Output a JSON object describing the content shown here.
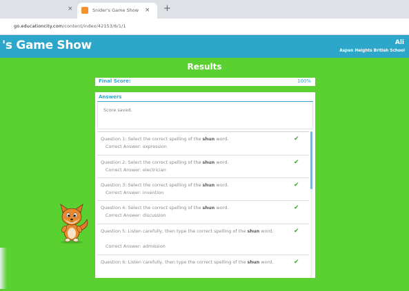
{
  "browser": {
    "prev_tab_close": "×",
    "tab_title": "Snider's Game Show",
    "tab_close": "×",
    "new_tab": "+",
    "url_domain": "go.educationcity.com",
    "url_path": "/content/index/42153/6/1/1"
  },
  "header": {
    "title": "'s Game Show",
    "user": "Ali",
    "school": "Aspen Heights British School"
  },
  "results": {
    "title": "Results",
    "score_label": "Final Score:",
    "score_value": "100%"
  },
  "answers": {
    "header": "Answers",
    "saved": "Score saved."
  },
  "questions": [
    {
      "pre": "Question 1: Select the correct spelling of the ",
      "bold": "shun",
      "post": " word.",
      "answer": "Correct Answer:  expression"
    },
    {
      "pre": "Question 2: Select the correct spelling of the ",
      "bold": "shun",
      "post": " word.",
      "answer": "Correct Answer:  electrician"
    },
    {
      "pre": "Question 3: Select the correct spelling of the ",
      "bold": "shun",
      "post": " word.",
      "answer": "Correct Answer:  invention"
    },
    {
      "pre": "Question 4: Select the correct spelling of the ",
      "bold": "shun",
      "post": " word.",
      "answer": "Correct Answer:  discussion"
    },
    {
      "pre": "Question 5: Listen carefully, then type the correct spelling of the ",
      "bold": "shun",
      "post": " word.",
      "answer": "Correct Answer:  admission"
    },
    {
      "pre": "Question 6: Listen carefully, then type the correct spelling of the ",
      "bold": "shun",
      "post": " word.",
      "answer": ""
    }
  ],
  "icons": {
    "check": "check-icon",
    "mascot": "fox-mascot-icon",
    "favicon": "educationcity-favicon-icon"
  },
  "colors": {
    "stage_green": "#5ad130",
    "header_blue": "#2ca7c9",
    "accent_blue": "#2fa8cc",
    "check_green": "#3aa72a"
  }
}
